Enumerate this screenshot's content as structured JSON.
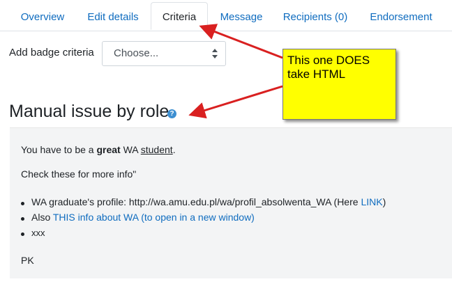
{
  "tabs": [
    {
      "label": "Overview",
      "active": false
    },
    {
      "label": "Edit details",
      "active": false
    },
    {
      "label": "Criteria",
      "active": true
    },
    {
      "label": "Message",
      "active": false
    },
    {
      "label": "Recipients (0)",
      "active": false
    },
    {
      "label": "Endorsement",
      "active": false
    }
  ],
  "criteria": {
    "label": "Add badge criteria",
    "select_value": "Choose..."
  },
  "section": {
    "title": "Manual issue by role",
    "help_icon": "question-circle-icon"
  },
  "description": {
    "line1_pre": "You have to be a ",
    "line1_bold": "great",
    "line1_mid": " WA ",
    "line1_underline": "student",
    "line1_post": ".",
    "line2": "Check these for more info\"",
    "bullets": [
      {
        "text": "WA graduate's profile: http://wa.amu.edu.pl/wa/profil_absolwenta_WA (Here ",
        "link": "LINK",
        "after": ")"
      },
      {
        "text": "Also ",
        "link": "THIS info about WA (to open in a new window)",
        "after": ""
      },
      {
        "text": "xxx",
        "link": "",
        "after": ""
      }
    ],
    "signature": "PK"
  },
  "annotation": {
    "text": "This one DOES\ntake HTML",
    "color": "#ffff00",
    "arrow_color": "#d92020"
  },
  "colors": {
    "link": "#0f6cbf",
    "text": "#1d2125",
    "box_bg": "#f3f4f5"
  }
}
